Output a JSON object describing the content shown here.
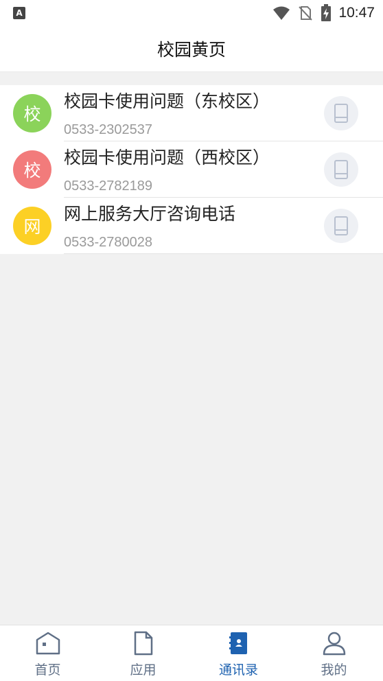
{
  "status_bar": {
    "left_icon": "A",
    "time": "10:47",
    "icons": [
      "wifi-icon",
      "no-sim-icon",
      "battery-charging-icon"
    ]
  },
  "header": {
    "title": "校园黄页"
  },
  "contacts": [
    {
      "avatar_char": "校",
      "avatar_color": "#8bd35a",
      "name": "校园卡使用问题（东校区）",
      "phone": "0533-2302537"
    },
    {
      "avatar_char": "校",
      "avatar_color": "#f27b7b",
      "name": "校园卡使用问题（西校区）",
      "phone": "0533-2782189"
    },
    {
      "avatar_char": "网",
      "avatar_color": "#fcd025",
      "name": "网上服务大厅咨询电话",
      "phone": "0533-2780028"
    }
  ],
  "tabs": [
    {
      "label": "首页",
      "icon": "home-icon",
      "active": false
    },
    {
      "label": "应用",
      "icon": "document-icon",
      "active": false
    },
    {
      "label": "通讯录",
      "icon": "contacts-book-icon",
      "active": true
    },
    {
      "label": "我的",
      "icon": "person-icon",
      "active": false
    }
  ],
  "colors": {
    "active_tab": "#1e62b0",
    "inactive_tab": "#5f6f86",
    "background": "#f1f1f1"
  }
}
